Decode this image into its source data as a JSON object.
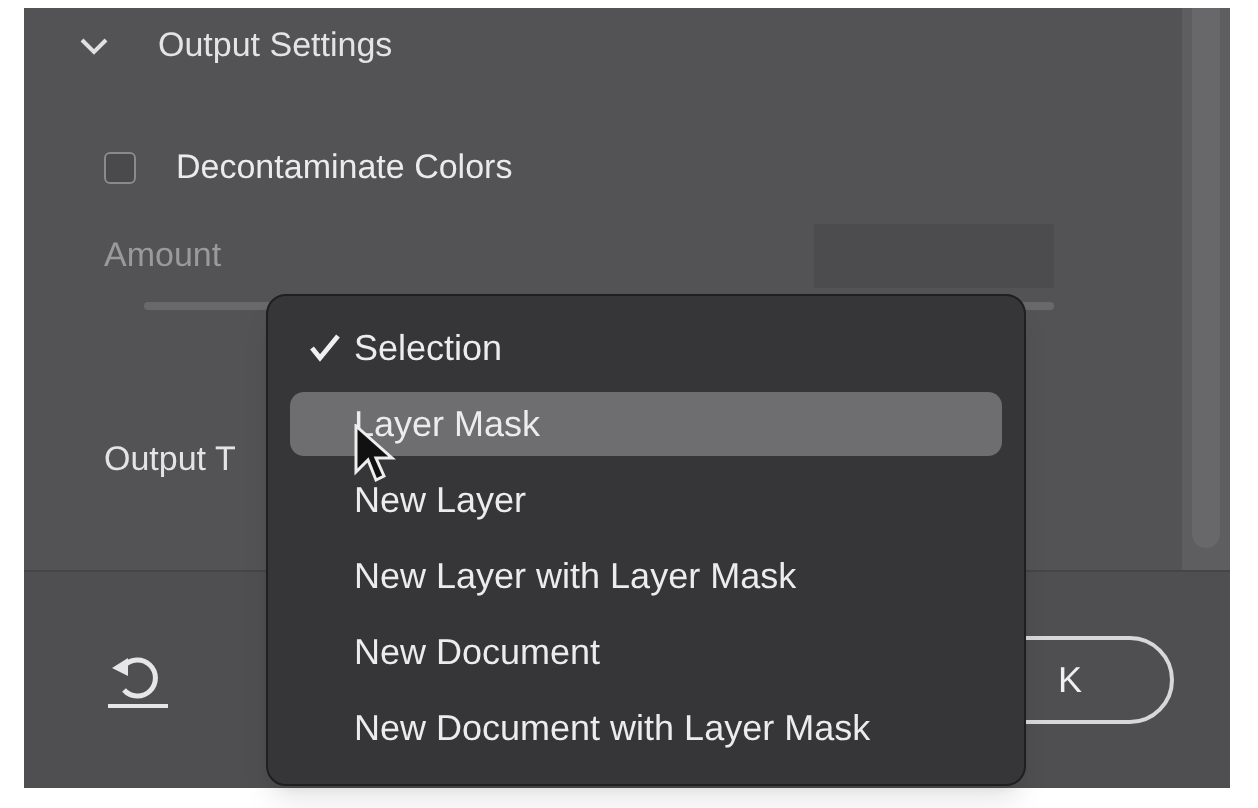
{
  "section": {
    "title": "Output Settings",
    "expanded": true
  },
  "decontaminate": {
    "label": "Decontaminate Colors",
    "checked": false
  },
  "amount": {
    "label": "Amount",
    "disabled": true
  },
  "output_to": {
    "label": "Output T"
  },
  "ok_button": {
    "label": "K"
  },
  "menu": {
    "items": [
      {
        "label": "Selection",
        "checked": true,
        "highlighted": false
      },
      {
        "label": "Layer Mask",
        "checked": false,
        "highlighted": true
      },
      {
        "label": "New Layer",
        "checked": false,
        "highlighted": false
      },
      {
        "label": "New Layer with Layer Mask",
        "checked": false,
        "highlighted": false
      },
      {
        "label": "New Document",
        "checked": false,
        "highlighted": false
      },
      {
        "label": "New Document with Layer Mask",
        "checked": false,
        "highlighted": false
      }
    ]
  }
}
